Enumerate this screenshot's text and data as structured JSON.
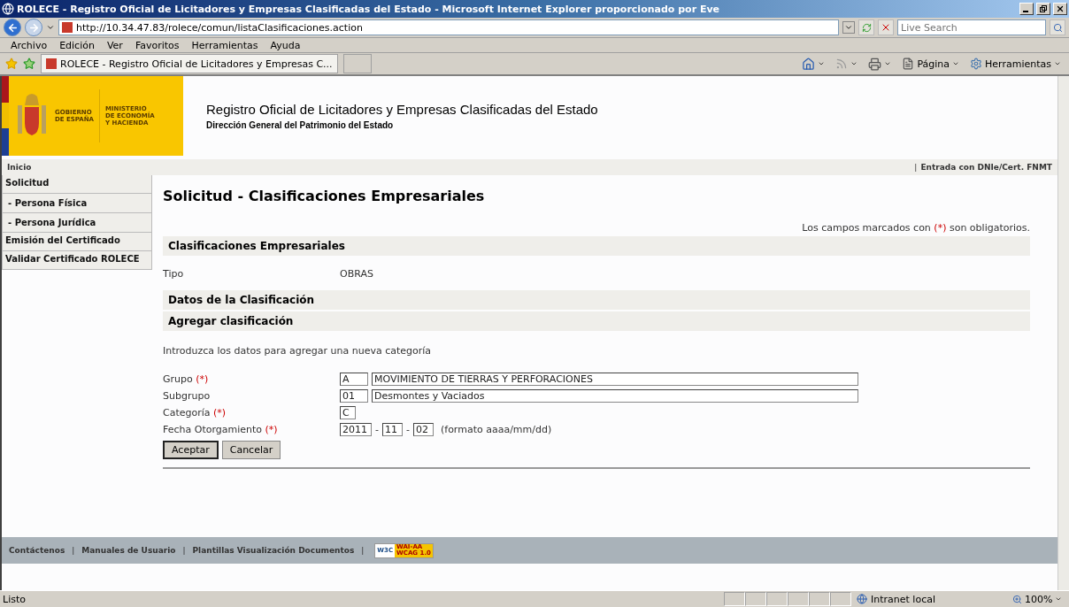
{
  "window": {
    "title": "ROLECE - Registro Oficial de Licitadores y Empresas Clasificadas del Estado - Microsoft Internet Explorer proporcionado por Eve"
  },
  "address": {
    "url": "http://10.34.47.83/rolece/comun/listaClasificaciones.action"
  },
  "search": {
    "placeholder": "Live Search"
  },
  "menu": [
    "Archivo",
    "Edición",
    "Ver",
    "Favoritos",
    "Herramientas",
    "Ayuda"
  ],
  "tabs": [
    {
      "label": "ROLECE - Registro Oficial de Licitadores y Empresas C...",
      "selected": true
    }
  ],
  "command_bar": [
    {
      "kind": "home"
    },
    {
      "kind": "feed"
    },
    {
      "kind": "print"
    },
    {
      "kind": "page",
      "label": "Página"
    },
    {
      "kind": "tools",
      "label": "Herramientas"
    }
  ],
  "header": {
    "logo_left": [
      "GOBIERNO",
      "DE ESPAÑA"
    ],
    "logo_right": [
      "MINISTERIO",
      "DE ECONOMÍA",
      "Y HACIENDA"
    ],
    "title": "Registro Oficial de Licitadores y Empresas Clasificadas del Estado",
    "subtitle": "Dirección General del Patrimonio del Estado"
  },
  "nav": {
    "home": "Inicio",
    "separator": "|",
    "login": "Entrada con DNIe/Cert. FNMT"
  },
  "sidebar": {
    "items": [
      {
        "label": "Solicitud",
        "children": [
          {
            "label": "- Persona Física"
          },
          {
            "label": "- Persona Jurídica"
          }
        ]
      },
      {
        "label": "Emisión del Certificado"
      },
      {
        "label": "Validar Certificado ROLECE"
      }
    ]
  },
  "content": {
    "title": "Solicitud - Clasificaciones Empresariales",
    "required_note": {
      "before": "Los campos marcados con",
      "mark": "(*)",
      "after": "son obligatorios."
    },
    "sections": [
      {
        "kind": "header",
        "label": "Clasificaciones Empresariales"
      },
      {
        "kind": "row",
        "label": "Tipo",
        "value": "OBRAS"
      },
      {
        "kind": "header",
        "label": "Datos de la Clasificación"
      },
      {
        "kind": "header",
        "label": "Agregar clasificación"
      },
      {
        "kind": "text",
        "label": "Introduzca los datos para agregar una nueva categoría"
      }
    ],
    "fields": [
      {
        "label": "Grupo",
        "mark": "(*)",
        "kind": "code",
        "code": "A",
        "value": "MOVIMIENTO DE TIERRAS Y PERFORACIONES"
      },
      {
        "label": "Subgrupo",
        "kind": "code",
        "code": "01",
        "value": "Desmontes y Vaciados"
      },
      {
        "label": "Categoría",
        "mark": "(*)",
        "kind": "single",
        "code": "C"
      },
      {
        "label": "Fecha Otorgamiento",
        "mark": "(*)",
        "kind": "date",
        "parts": [
          "2011",
          "11",
          "02"
        ],
        "separator": "-",
        "hint": "(formato aaaa/mm/dd)"
      }
    ],
    "buttons": [
      {
        "label": "Aceptar",
        "default": true
      },
      {
        "label": "Cancelar",
        "default": false
      }
    ]
  },
  "footer": {
    "links": [
      "Contáctenos",
      "Manuales de Usuario",
      "Plantillas Visualización Documentos"
    ],
    "separator": "|",
    "badge": {
      "left": "W3C",
      "top": "WAI-AA",
      "bottom": "WCAG 1.0"
    }
  },
  "status_bar": {
    "text": "Listo",
    "zone": "Intranet local",
    "zoom": "100%"
  }
}
